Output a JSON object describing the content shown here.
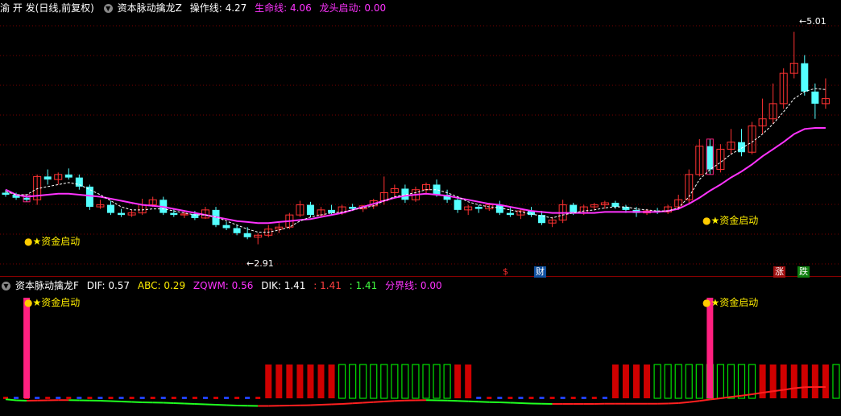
{
  "main_header": {
    "stock": "渝 开 发",
    "period": "(日线,前复权)",
    "indicator": "资本脉动擒龙Z",
    "op_label": "操作线: 4.27",
    "life_label": "生命线: 4.06",
    "dragon_label": "龙头启动: 0.00"
  },
  "sub_header": {
    "indicator": "资本脉动擒龙F",
    "dif": "DIF: 0.57",
    "abc": "ABC: 0.29",
    "zqwm": "ZQWM: 0.56",
    "dik": "DIK: 1.41",
    "v1": ": 1.41",
    "v2": ": 1.41",
    "fenjie": "分界线: 0.00"
  },
  "annotations": {
    "high": "5.01",
    "low": "2.91",
    "signal": "资金启动",
    "markers": [
      "$",
      "财",
      "涨",
      "跌"
    ]
  },
  "colors": {
    "up": "#ff3232",
    "down": "#54ffff",
    "life_line": "#ff33ff",
    "op_line": "#ffffff",
    "bar_red": "#d00000",
    "bar_green": "#00e000",
    "spike": "#ff2080"
  },
  "chart_data": {
    "type": "candlestick",
    "ylim": [
      2.7,
      5.15
    ],
    "candles": [
      [
        3.42,
        3.45,
        3.38,
        3.4
      ],
      [
        3.4,
        3.42,
        3.35,
        3.37
      ],
      [
        3.37,
        3.4,
        3.33,
        3.35
      ],
      [
        3.35,
        3.6,
        3.3,
        3.58
      ],
      [
        3.58,
        3.65,
        3.5,
        3.55
      ],
      [
        3.55,
        3.62,
        3.5,
        3.6
      ],
      [
        3.6,
        3.66,
        3.55,
        3.57
      ],
      [
        3.57,
        3.6,
        3.45,
        3.48
      ],
      [
        3.48,
        3.5,
        3.25,
        3.28
      ],
      [
        3.28,
        3.35,
        3.26,
        3.3
      ],
      [
        3.3,
        3.34,
        3.2,
        3.22
      ],
      [
        3.22,
        3.26,
        3.18,
        3.2
      ],
      [
        3.2,
        3.25,
        3.18,
        3.22
      ],
      [
        3.22,
        3.36,
        3.2,
        3.3
      ],
      [
        3.3,
        3.38,
        3.28,
        3.35
      ],
      [
        3.35,
        3.38,
        3.2,
        3.22
      ],
      [
        3.22,
        3.26,
        3.18,
        3.2
      ],
      [
        3.2,
        3.24,
        3.17,
        3.21
      ],
      [
        3.21,
        3.24,
        3.15,
        3.17
      ],
      [
        3.17,
        3.28,
        3.16,
        3.25
      ],
      [
        3.25,
        3.28,
        3.08,
        3.1
      ],
      [
        3.1,
        3.13,
        3.05,
        3.07
      ],
      [
        3.07,
        3.1,
        3.0,
        3.02
      ],
      [
        3.02,
        3.08,
        2.96,
        2.98
      ],
      [
        2.98,
        3.02,
        2.91,
        3.0
      ],
      [
        3.0,
        3.1,
        2.98,
        3.06
      ],
      [
        3.06,
        3.12,
        3.02,
        3.08
      ],
      [
        3.08,
        3.22,
        3.06,
        3.2
      ],
      [
        3.2,
        3.34,
        3.18,
        3.3
      ],
      [
        3.3,
        3.33,
        3.18,
        3.2
      ],
      [
        3.2,
        3.28,
        3.18,
        3.25
      ],
      [
        3.25,
        3.3,
        3.2,
        3.22
      ],
      [
        3.22,
        3.3,
        3.2,
        3.28
      ],
      [
        3.28,
        3.31,
        3.24,
        3.26
      ],
      [
        3.26,
        3.3,
        3.23,
        3.29
      ],
      [
        3.29,
        3.36,
        3.26,
        3.34
      ],
      [
        3.34,
        3.58,
        3.3,
        3.42
      ],
      [
        3.42,
        3.5,
        3.38,
        3.46
      ],
      [
        3.46,
        3.5,
        3.32,
        3.35
      ],
      [
        3.35,
        3.48,
        3.33,
        3.45
      ],
      [
        3.45,
        3.52,
        3.4,
        3.5
      ],
      [
        3.5,
        3.55,
        3.38,
        3.4
      ],
      [
        3.4,
        3.45,
        3.32,
        3.35
      ],
      [
        3.35,
        3.38,
        3.22,
        3.25
      ],
      [
        3.25,
        3.3,
        3.2,
        3.28
      ],
      [
        3.28,
        3.3,
        3.22,
        3.26
      ],
      [
        3.26,
        3.32,
        3.24,
        3.3
      ],
      [
        3.3,
        3.34,
        3.2,
        3.22
      ],
      [
        3.22,
        3.28,
        3.18,
        3.2
      ],
      [
        3.2,
        3.26,
        3.16,
        3.24
      ],
      [
        3.24,
        3.28,
        3.18,
        3.2
      ],
      [
        3.2,
        3.24,
        3.1,
        3.12
      ],
      [
        3.12,
        3.18,
        3.08,
        3.15
      ],
      [
        3.15,
        3.35,
        3.12,
        3.3
      ],
      [
        3.3,
        3.32,
        3.2,
        3.22
      ],
      [
        3.22,
        3.3,
        3.2,
        3.28
      ],
      [
        3.28,
        3.32,
        3.25,
        3.3
      ],
      [
        3.3,
        3.34,
        3.26,
        3.32
      ],
      [
        3.32,
        3.34,
        3.26,
        3.28
      ],
      [
        3.28,
        3.3,
        3.22,
        3.25
      ],
      [
        3.25,
        3.28,
        3.18,
        3.22
      ],
      [
        3.22,
        3.26,
        3.2,
        3.24
      ],
      [
        3.24,
        3.27,
        3.21,
        3.23
      ],
      [
        3.23,
        3.3,
        3.21,
        3.28
      ],
      [
        3.28,
        3.4,
        3.25,
        3.35
      ],
      [
        3.35,
        3.65,
        3.32,
        3.6
      ],
      [
        3.6,
        3.95,
        3.58,
        3.88
      ],
      [
        3.88,
        3.95,
        3.6,
        3.65
      ],
      [
        3.65,
        3.9,
        3.62,
        3.85
      ],
      [
        3.85,
        4.05,
        3.8,
        3.92
      ],
      [
        3.92,
        4.05,
        3.78,
        3.82
      ],
      [
        3.82,
        4.12,
        3.8,
        4.08
      ],
      [
        4.08,
        4.35,
        4.0,
        4.15
      ],
      [
        4.15,
        4.5,
        4.1,
        4.3
      ],
      [
        4.3,
        4.65,
        4.25,
        4.6
      ],
      [
        4.6,
        5.01,
        4.55,
        4.7
      ],
      [
        4.7,
        4.78,
        4.38,
        4.42
      ],
      [
        4.42,
        4.5,
        4.15,
        4.3
      ],
      [
        4.3,
        4.55,
        4.25,
        4.35
      ]
    ],
    "life_line": [
      3.45,
      3.4,
      3.38,
      3.39,
      3.4,
      3.41,
      3.41,
      3.4,
      3.39,
      3.38,
      3.36,
      3.34,
      3.32,
      3.3,
      3.29,
      3.28,
      3.26,
      3.24,
      3.22,
      3.2,
      3.18,
      3.16,
      3.14,
      3.13,
      3.12,
      3.12,
      3.13,
      3.14,
      3.15,
      3.16,
      3.18,
      3.2,
      3.22,
      3.25,
      3.28,
      3.31,
      3.34,
      3.37,
      3.39,
      3.4,
      3.41,
      3.4,
      3.39,
      3.37,
      3.35,
      3.33,
      3.31,
      3.3,
      3.28,
      3.26,
      3.24,
      3.23,
      3.22,
      3.22,
      3.22,
      3.22,
      3.22,
      3.23,
      3.23,
      3.23,
      3.23,
      3.23,
      3.23,
      3.24,
      3.26,
      3.31,
      3.37,
      3.44,
      3.5,
      3.57,
      3.63,
      3.7,
      3.78,
      3.85,
      3.92,
      4.0,
      4.05,
      4.06,
      4.06
    ],
    "op_line": [
      3.43,
      3.4,
      3.4,
      3.46,
      3.48,
      3.5,
      3.52,
      3.5,
      3.45,
      3.4,
      3.34,
      3.28,
      3.25,
      3.25,
      3.26,
      3.26,
      3.24,
      3.22,
      3.2,
      3.2,
      3.18,
      3.14,
      3.1,
      3.06,
      3.03,
      3.03,
      3.05,
      3.08,
      3.14,
      3.18,
      3.2,
      3.22,
      3.23,
      3.25,
      3.27,
      3.29,
      3.34,
      3.38,
      3.4,
      3.42,
      3.45,
      3.45,
      3.42,
      3.38,
      3.33,
      3.3,
      3.28,
      3.27,
      3.25,
      3.23,
      3.21,
      3.19,
      3.17,
      3.2,
      3.22,
      3.24,
      3.25,
      3.27,
      3.28,
      3.28,
      3.26,
      3.25,
      3.24,
      3.24,
      3.27,
      3.38,
      3.55,
      3.65,
      3.72,
      3.8,
      3.86,
      3.92,
      4.0,
      4.1,
      4.22,
      4.35,
      4.42,
      4.45,
      4.44
    ],
    "sub_bars": [
      "n",
      "n",
      "n",
      "n",
      "n",
      "n",
      "n",
      "n",
      "n",
      "n",
      "n",
      "n",
      "n",
      "n",
      "n",
      "n",
      "n",
      "n",
      "n",
      "n",
      "n",
      "n",
      "n",
      "n",
      "n",
      "r",
      "r",
      "r",
      "r",
      "r",
      "r",
      "r",
      "g",
      "g",
      "g",
      "g",
      "g",
      "g",
      "g",
      "g",
      "g",
      "g",
      "g",
      "r",
      "r",
      "n",
      "n",
      "n",
      "n",
      "n",
      "n",
      "n",
      "n",
      "n",
      "n",
      "n",
      "n",
      "n",
      "r",
      "r",
      "r",
      "r",
      "g",
      "g",
      "g",
      "g",
      "g",
      "g",
      "g",
      "g",
      "g",
      "g",
      "r",
      "r",
      "r",
      "r",
      "r",
      "r",
      "r",
      "g",
      "g",
      "g",
      "g"
    ]
  }
}
